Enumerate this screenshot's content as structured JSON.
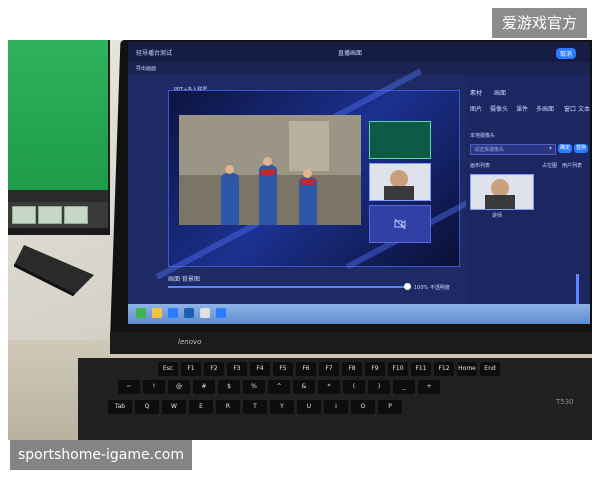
{
  "watermarks": {
    "top_right": "爱游戏官方",
    "bottom_left": "sportshome-igame.com"
  },
  "laptop": {
    "brand": "lenovo",
    "model": "T530",
    "keys": {
      "row_fn": [
        "Esc",
        "F1",
        "F2",
        "F3",
        "F4",
        "F5",
        "F6",
        "F7",
        "F8",
        "F9",
        "F10",
        "F11",
        "F12",
        "Home",
        "End"
      ],
      "row_num": [
        "~",
        "!",
        "@",
        "#",
        "$",
        "%",
        "^",
        "&",
        "*",
        "(",
        ")",
        "_",
        "+"
      ],
      "row_q": [
        "Tab",
        "Q",
        "W",
        "E",
        "R",
        "T",
        "Y",
        "U",
        "I",
        "O",
        "P"
      ]
    }
  },
  "app": {
    "title": "轻导播台测试",
    "menu_item": "导出画面",
    "top_center_button": "直播画面",
    "scene_tab": "PPT+多人联屏",
    "timeline_label": "画面·背景图",
    "timeline_percent": "100% 不透明度",
    "panel": {
      "tabs": [
        "素材",
        "画面"
      ],
      "subtabs": [
        "图片",
        "摄像头",
        "课件",
        "多画面",
        "窗口",
        "文本"
      ],
      "camera_label": "本地摄像头",
      "select_placeholder": "请选择摄像头",
      "confirm_button": "确定",
      "switch_button": "替换",
      "list_label": "画布列表",
      "camera_name": "讲师",
      "placeholder_label": "占位图",
      "user_list_label": "用户列表",
      "cancel_button": "取消"
    }
  },
  "colors": {
    "screen_bg": "#1e2a63",
    "accent": "#2b7bff",
    "green_screen": "#2fb35a",
    "taskbar": "#5d8cd0"
  }
}
